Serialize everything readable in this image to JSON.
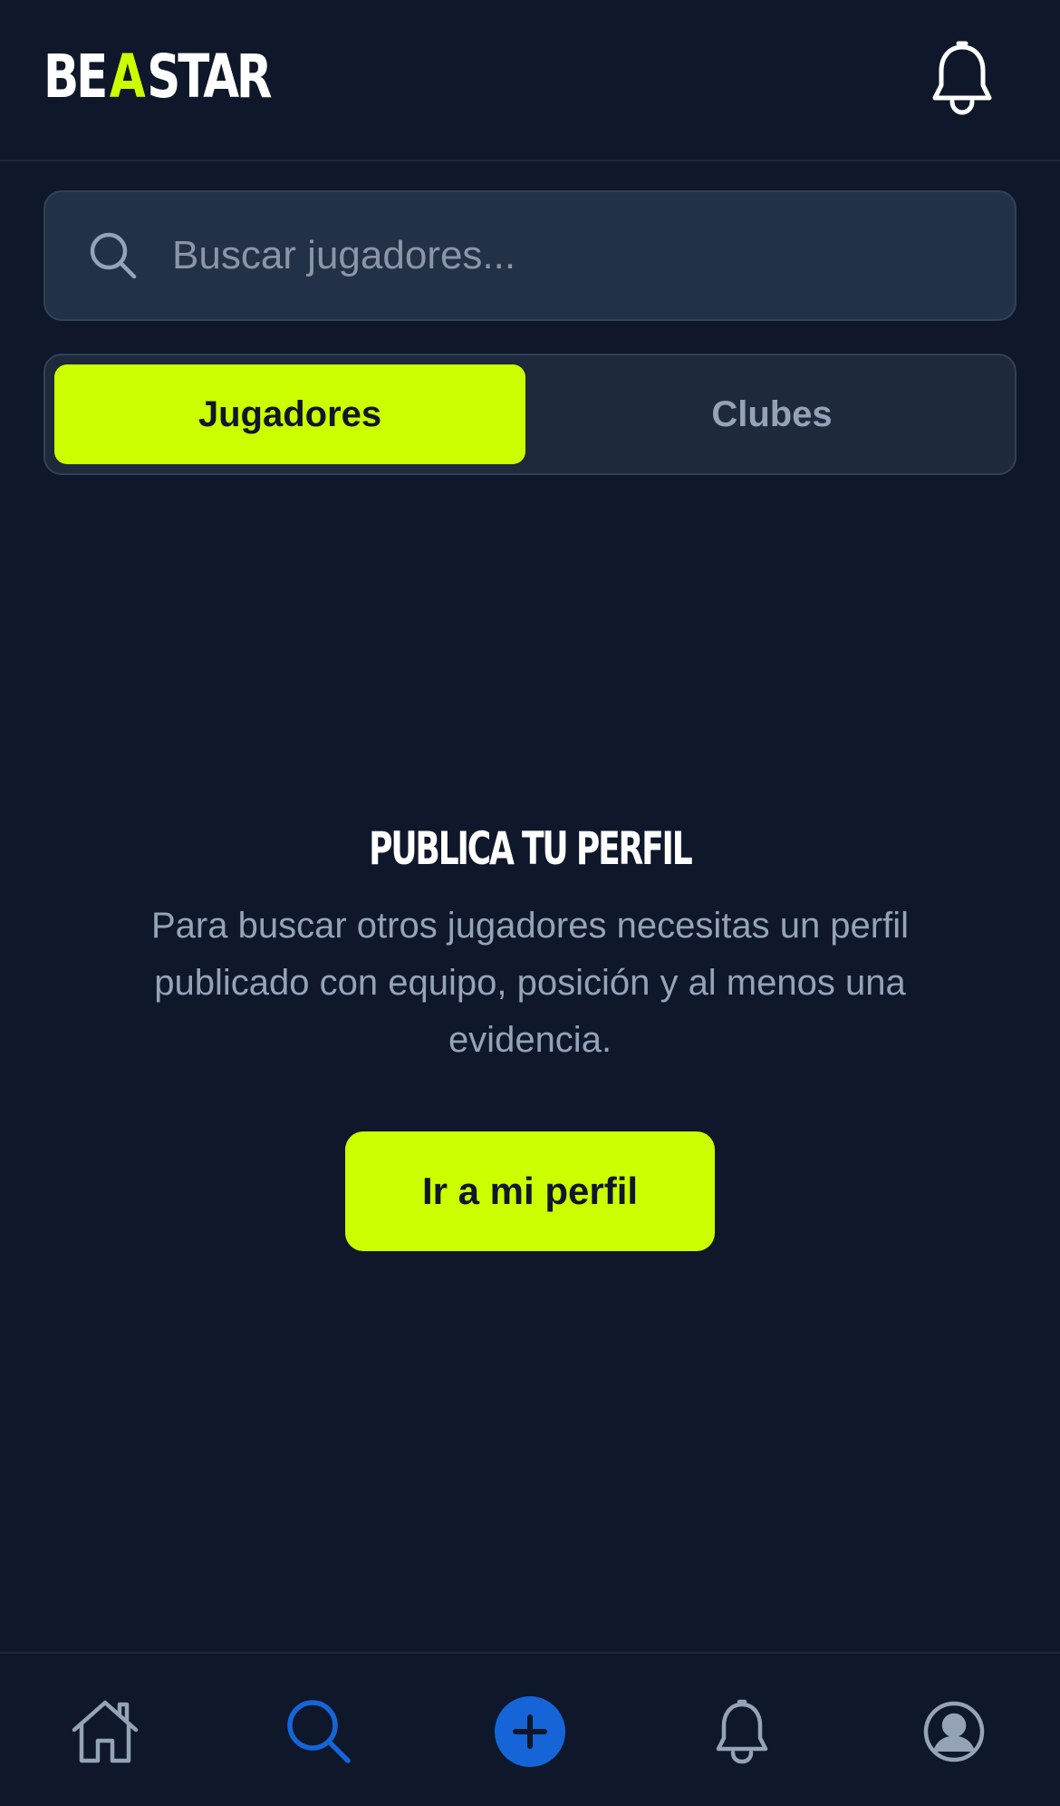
{
  "header": {
    "logo": {
      "part1": "BE",
      "part2": "A",
      "part3": "STAR"
    },
    "notifications_icon": "bell-icon"
  },
  "search": {
    "placeholder": "Buscar jugadores...",
    "value": "",
    "icon": "search-icon"
  },
  "tabs": [
    {
      "label": "Jugadores",
      "active": true
    },
    {
      "label": "Clubes",
      "active": false
    }
  ],
  "empty_state": {
    "title": "PUBLICA TU PERFIL",
    "description": "Para buscar otros jugadores necesitas un perfil publicado con equipo, posición y al menos una evidencia.",
    "button_label": "Ir a mi perfil"
  },
  "bottom_nav": [
    {
      "icon": "home-icon",
      "active": false
    },
    {
      "icon": "search-icon",
      "active": true
    },
    {
      "icon": "plus-icon",
      "active": false
    },
    {
      "icon": "bell-icon",
      "active": false
    },
    {
      "icon": "user-icon",
      "active": false
    }
  ],
  "colors": {
    "background": "#0f172a",
    "accent": "#ccff00",
    "active_nav": "#1565d8",
    "muted_text": "#94a3b8",
    "surface": "#1e293b"
  }
}
